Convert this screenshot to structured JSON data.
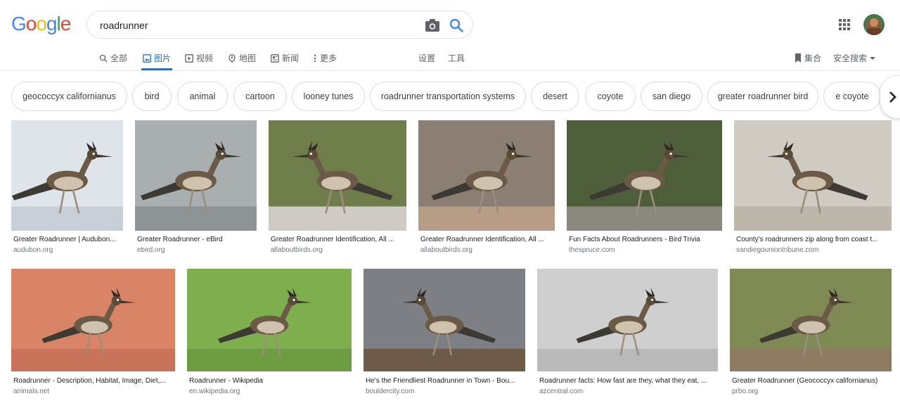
{
  "logo": {
    "letters": [
      "G",
      "o",
      "o",
      "g",
      "l",
      "e"
    ],
    "colors": [
      "#4285f4",
      "#ea4335",
      "#fbbc05",
      "#4285f4",
      "#34a853",
      "#ea4335"
    ]
  },
  "search": {
    "value": "roadrunner",
    "placeholder": ""
  },
  "nav": {
    "items": [
      {
        "label": "全部",
        "icon": "search-icon"
      },
      {
        "label": "图片",
        "icon": "image-icon",
        "active": true
      },
      {
        "label": "视频",
        "icon": "play-icon"
      },
      {
        "label": "地图",
        "icon": "map-pin-icon"
      },
      {
        "label": "新闻",
        "icon": "news-icon"
      },
      {
        "label": "更多",
        "icon": "more-vert-icon"
      }
    ],
    "settings_label": "设置",
    "tools_label": "工具",
    "collections_label": "集合",
    "safesearch_label": "安全搜索"
  },
  "chips": [
    "geococcyx californianus",
    "bird",
    "animal",
    "cartoon",
    "looney tunes",
    "roadrunner transportation systems",
    "desert",
    "coyote",
    "san diego",
    "greater roadrunner bird",
    "e coyote"
  ],
  "results": [
    {
      "caption": "Greater Roadrunner | Audubon...",
      "domain": "audubon.org",
      "bg": "#dfe4ea",
      "ground": "#c8ced6"
    },
    {
      "caption": "Greater Roadrunner - eBird",
      "domain": "ebird.org",
      "bg": "#a9aeb0",
      "ground": "#8e9395"
    },
    {
      "caption": "Greater Roadrunner Identification, All ...",
      "domain": "allaboutbirds.org",
      "bg": "#6e7d4a",
      "ground": "#cfcac3"
    },
    {
      "caption": "Greater Roadrunner Identification, All ...",
      "domain": "allaboutbirds.org",
      "bg": "#8a7f72",
      "ground": "#b79c86"
    },
    {
      "caption": "Fun Facts About Roadrunners - Bird Trivia",
      "domain": "thespruce.com",
      "bg": "#4f5e3a",
      "ground": "#8a877d"
    },
    {
      "caption": "County's roadrunners zip along from coast t...",
      "domain": "sandiegouniontribune.com",
      "bg": "#cfcac2",
      "ground": "#bdb6ab"
    },
    {
      "caption": "Roadrunner - Description, Habitat, Image, Diet,...",
      "domain": "animals.net",
      "bg": "#d98367",
      "ground": "#c9745a"
    },
    {
      "caption": "Roadrunner - Wikipedia",
      "domain": "en.wikipedia.org",
      "bg": "#7fae4f",
      "ground": "#6d9c42"
    },
    {
      "caption": "He's the Friendliest Roadrunner in Town - Bou...",
      "domain": "bouldercity.com",
      "bg": "#7c7f84",
      "ground": "#6d5b47"
    },
    {
      "caption": "Roadrunner facts: How fast are they, what they eat, ...",
      "domain": "azcentral.com",
      "bg": "#cfcfcf",
      "ground": "#b9b9b9"
    },
    {
      "caption": "Greater Roadrunner (Geococcyx californianus)",
      "domain": "prbo.org",
      "bg": "#7f8a55",
      "ground": "#8f7b62"
    }
  ],
  "colors": {
    "accent": "#1a73e8",
    "text_secondary": "#70757a"
  }
}
